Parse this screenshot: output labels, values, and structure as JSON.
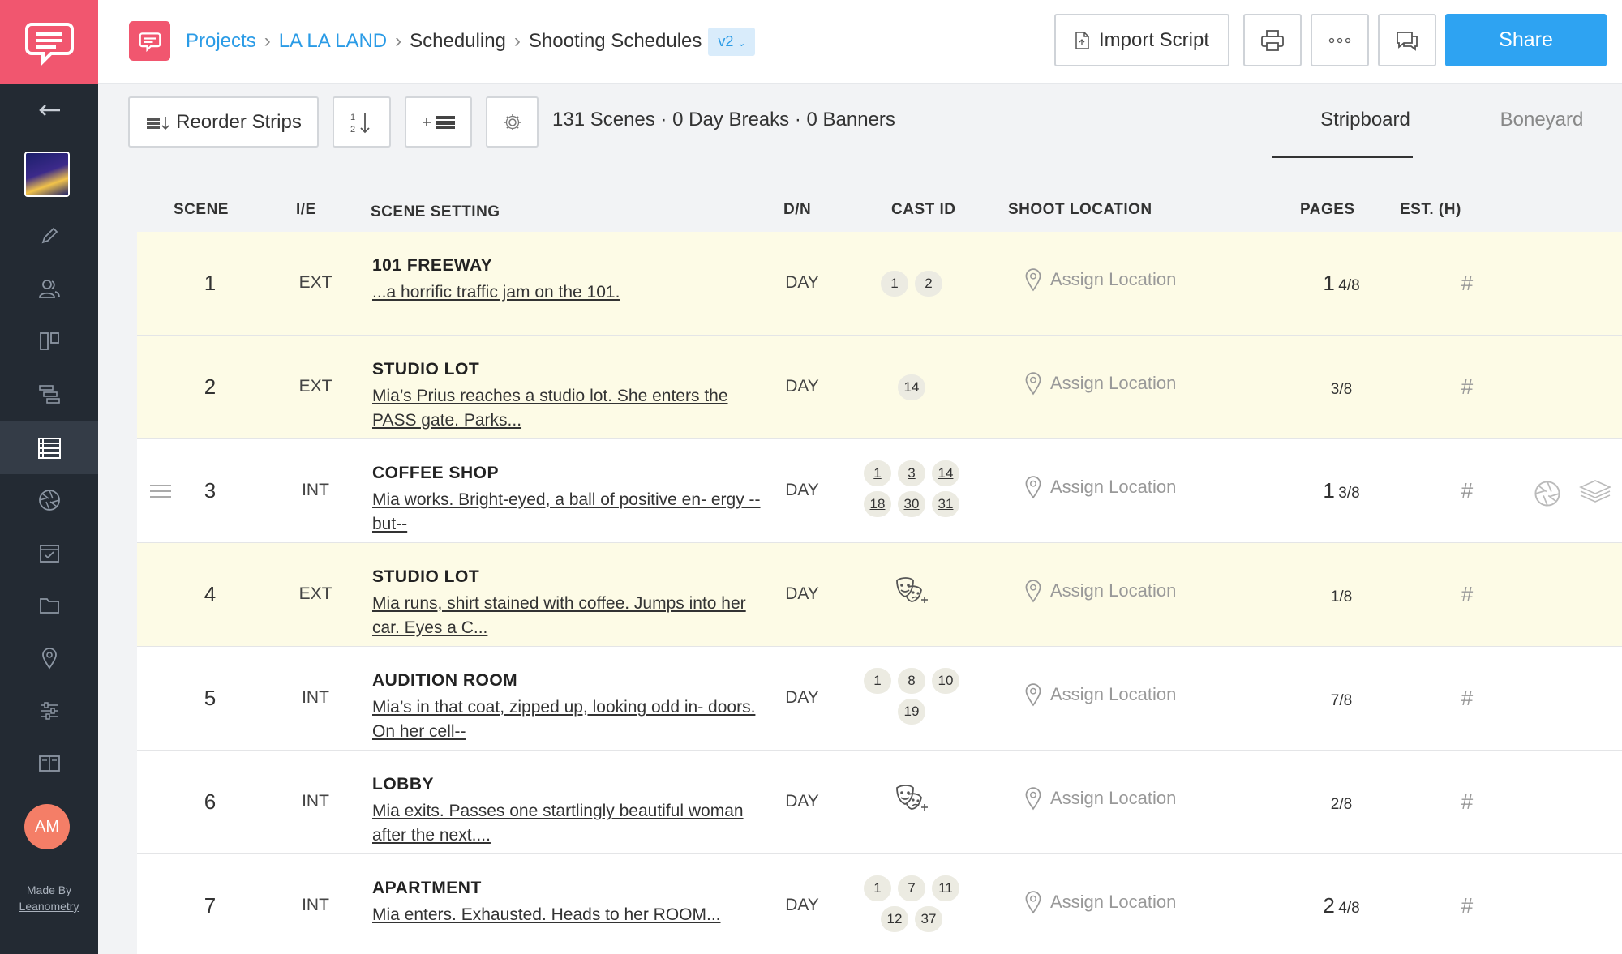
{
  "sidebar": {
    "items": [
      {
        "icon": "back-arrow-icon"
      },
      {
        "icon": "project-thumbnail"
      },
      {
        "icon": "pencil-icon"
      },
      {
        "icon": "characters-icon"
      },
      {
        "icon": "storyboard-icon"
      },
      {
        "icon": "timeline-icon"
      },
      {
        "icon": "stripboard-icon",
        "active": true
      },
      {
        "icon": "aperture-icon"
      },
      {
        "icon": "calendar-check-icon"
      },
      {
        "icon": "folder-icon"
      },
      {
        "icon": "location-pin-icon"
      },
      {
        "icon": "sliders-icon"
      },
      {
        "icon": "book-icon"
      }
    ],
    "avatar": "AM",
    "made_by": "Made By",
    "brand": "Leanometry"
  },
  "header": {
    "breadcrumbs": [
      "Projects",
      "LA LA LAND",
      "Scheduling",
      "Shooting Schedules"
    ],
    "version": "v2",
    "import_label": "Import Script",
    "share_label": "Share"
  },
  "toolbar": {
    "reorder_label": "Reorder Strips",
    "summary": "131 Scenes · 0 Day Breaks · 0 Banners",
    "tabs": [
      "Stripboard",
      "Boneyard"
    ],
    "active_tab": "Stripboard"
  },
  "table": {
    "columns": [
      "SCENE",
      "I/E",
      "SCENE SETTING",
      "D/N",
      "CAST ID",
      "SHOOT LOCATION",
      "PAGES",
      "EST. (H)"
    ],
    "rows": [
      {
        "scene": "1",
        "ie": "EXT",
        "title": "101 FREEWAY",
        "desc": "...a horrific traffic jam on the 101.",
        "dn": "DAY",
        "cast": [
          "1",
          "2"
        ],
        "location": "Assign Location",
        "pages_whole": "1",
        "pages_frac": "4/8",
        "est": "#",
        "highlight": true
      },
      {
        "scene": "2",
        "ie": "EXT",
        "title": "STUDIO LOT",
        "desc": "Mia’s Prius reaches a studio lot. She enters the PASS gate. Parks...",
        "dn": "DAY",
        "cast": [
          "14"
        ],
        "location": "Assign Location",
        "pages_whole": "",
        "pages_frac": "3/8",
        "est": "#",
        "highlight": true
      },
      {
        "scene": "3",
        "ie": "INT",
        "title": "COFFEE SHOP",
        "desc": "Mia works. Bright-eyed, a ball of positive en- ergy -- but--",
        "dn": "DAY",
        "cast": [
          "1",
          "3",
          "14",
          "18",
          "30",
          "31"
        ],
        "location": "Assign Location",
        "pages_whole": "1",
        "pages_frac": "3/8",
        "est": "#",
        "highlight": false
      },
      {
        "scene": "4",
        "ie": "EXT",
        "title": "STUDIO LOT",
        "desc": "Mia runs, shirt stained with coffee. Jumps into her car. Eyes a C...",
        "dn": "DAY",
        "cast": [],
        "location": "Assign Location",
        "pages_whole": "",
        "pages_frac": "1/8",
        "est": "#",
        "highlight": true
      },
      {
        "scene": "5",
        "ie": "INT",
        "title": "AUDITION ROOM",
        "desc": "Mia’s in that coat, zipped up, looking odd in- doors. On her cell--",
        "dn": "DAY",
        "cast": [
          "1",
          "8",
          "10",
          "19"
        ],
        "location": "Assign Location",
        "pages_whole": "",
        "pages_frac": "7/8",
        "est": "#",
        "highlight": false
      },
      {
        "scene": "6",
        "ie": "INT",
        "title": "LOBBY",
        "desc": "Mia exits. Passes one startlingly beautiful woman after the next....",
        "dn": "DAY",
        "cast": [],
        "location": "Assign Location",
        "pages_whole": "",
        "pages_frac": "2/8",
        "est": "#",
        "highlight": false
      },
      {
        "scene": "7",
        "ie": "INT",
        "title": "APARTMENT",
        "desc": "Mia enters. Exhausted. Heads to her ROOM...",
        "dn": "DAY",
        "cast": [
          "1",
          "7",
          "11",
          "12",
          "37"
        ],
        "location": "Assign Location",
        "pages_whole": "2",
        "pages_frac": "4/8",
        "est": "#",
        "highlight": false
      }
    ]
  },
  "colors": {
    "brand_pink": "#f1566f",
    "share_blue": "#2ea3f2",
    "sidebar_dark": "#232a33",
    "strip_yellow": "#fdfbe6"
  }
}
